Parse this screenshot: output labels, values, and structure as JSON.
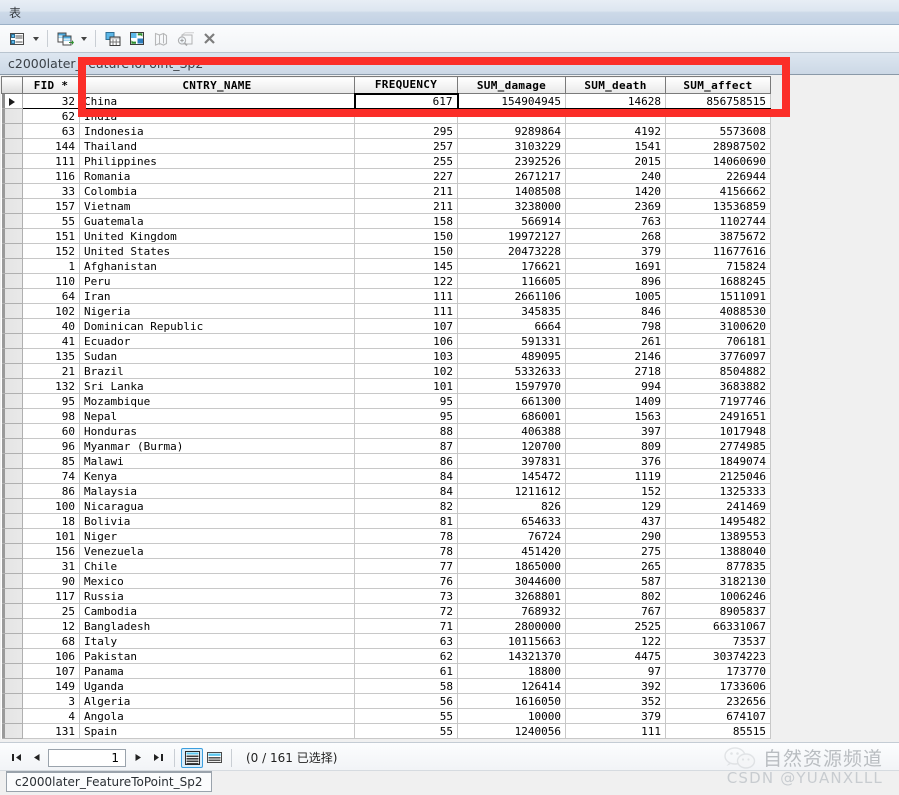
{
  "window": {
    "title": "表"
  },
  "toolbar": {
    "icons": [
      {
        "name": "table-options-icon",
        "label": "表选项"
      },
      {
        "name": "table-options-dropdown-icon",
        "label": ""
      },
      {
        "name": "related-tables-icon",
        "label": "相关表"
      },
      {
        "name": "related-tables-dropdown-icon",
        "label": ""
      },
      {
        "name": "select-all-icon",
        "label": "全选"
      },
      {
        "name": "switch-selection-icon",
        "label": "切换选择"
      },
      {
        "name": "zoom-to-selected-icon",
        "label": "缩放至所选"
      },
      {
        "name": "zoom-layer-icon",
        "label": "缩放"
      },
      {
        "name": "clear-selection-icon",
        "label": "清除所选内容"
      }
    ]
  },
  "layer_tab": {
    "name": "c2000later_FeatureToPoint_Sp2"
  },
  "table": {
    "columns": [
      {
        "key": "fid",
        "label": "FID *",
        "align": "right"
      },
      {
        "key": "name",
        "label": "CNTRY_NAME",
        "align": "left"
      },
      {
        "key": "freq",
        "label": "FREQUENCY",
        "align": "right"
      },
      {
        "key": "damage",
        "label": "SUM_damage",
        "align": "right"
      },
      {
        "key": "death",
        "label": "SUM_death",
        "align": "right"
      },
      {
        "key": "affect",
        "label": "SUM_affect",
        "align": "right"
      }
    ],
    "current_row_index": 0,
    "rows": [
      {
        "fid": "32",
        "name": "China",
        "freq": "617",
        "damage": "154904945",
        "death": "14628",
        "affect": "856758515"
      },
      {
        "fid": "62",
        "name": "India",
        "freq": "",
        "damage": "",
        "death": "",
        "affect": ""
      },
      {
        "fid": "63",
        "name": "Indonesia",
        "freq": "295",
        "damage": "9289864",
        "death": "4192",
        "affect": "5573608"
      },
      {
        "fid": "144",
        "name": "Thailand",
        "freq": "257",
        "damage": "3103229",
        "death": "1541",
        "affect": "28987502"
      },
      {
        "fid": "111",
        "name": "Philippines",
        "freq": "255",
        "damage": "2392526",
        "death": "2015",
        "affect": "14060690"
      },
      {
        "fid": "116",
        "name": "Romania",
        "freq": "227",
        "damage": "2671217",
        "death": "240",
        "affect": "226944"
      },
      {
        "fid": "33",
        "name": "Colombia",
        "freq": "211",
        "damage": "1408508",
        "death": "1420",
        "affect": "4156662"
      },
      {
        "fid": "157",
        "name": "Vietnam",
        "freq": "211",
        "damage": "3238000",
        "death": "2369",
        "affect": "13536859"
      },
      {
        "fid": "55",
        "name": "Guatemala",
        "freq": "158",
        "damage": "566914",
        "death": "763",
        "affect": "1102744"
      },
      {
        "fid": "151",
        "name": "United Kingdom",
        "freq": "150",
        "damage": "19972127",
        "death": "268",
        "affect": "3875672"
      },
      {
        "fid": "152",
        "name": "United States",
        "freq": "150",
        "damage": "20473228",
        "death": "379",
        "affect": "11677616"
      },
      {
        "fid": "1",
        "name": "Afghanistan",
        "freq": "145",
        "damage": "176621",
        "death": "1691",
        "affect": "715824"
      },
      {
        "fid": "110",
        "name": "Peru",
        "freq": "122",
        "damage": "116605",
        "death": "896",
        "affect": "1688245"
      },
      {
        "fid": "64",
        "name": "Iran",
        "freq": "111",
        "damage": "2661106",
        "death": "1005",
        "affect": "1511091"
      },
      {
        "fid": "102",
        "name": "Nigeria",
        "freq": "111",
        "damage": "345835",
        "death": "846",
        "affect": "4088530"
      },
      {
        "fid": "40",
        "name": "Dominican Republic",
        "freq": "107",
        "damage": "6664",
        "death": "798",
        "affect": "3100620"
      },
      {
        "fid": "41",
        "name": "Ecuador",
        "freq": "106",
        "damage": "591331",
        "death": "261",
        "affect": "706181"
      },
      {
        "fid": "135",
        "name": "Sudan",
        "freq": "103",
        "damage": "489095",
        "death": "2146",
        "affect": "3776097"
      },
      {
        "fid": "21",
        "name": "Brazil",
        "freq": "102",
        "damage": "5332633",
        "death": "2718",
        "affect": "8504882"
      },
      {
        "fid": "132",
        "name": "Sri Lanka",
        "freq": "101",
        "damage": "1597970",
        "death": "994",
        "affect": "3683882"
      },
      {
        "fid": "95",
        "name": "Mozambique",
        "freq": "95",
        "damage": "661300",
        "death": "1409",
        "affect": "7197746"
      },
      {
        "fid": "98",
        "name": "Nepal",
        "freq": "95",
        "damage": "686001",
        "death": "1563",
        "affect": "2491651"
      },
      {
        "fid": "60",
        "name": "Honduras",
        "freq": "88",
        "damage": "406388",
        "death": "397",
        "affect": "1017948"
      },
      {
        "fid": "96",
        "name": "Myanmar (Burma)",
        "freq": "87",
        "damage": "120700",
        "death": "809",
        "affect": "2774985"
      },
      {
        "fid": "85",
        "name": "Malawi",
        "freq": "86",
        "damage": "397831",
        "death": "376",
        "affect": "1849074"
      },
      {
        "fid": "74",
        "name": "Kenya",
        "freq": "84",
        "damage": "145472",
        "death": "1119",
        "affect": "2125046"
      },
      {
        "fid": "86",
        "name": "Malaysia",
        "freq": "84",
        "damage": "1211612",
        "death": "152",
        "affect": "1325333"
      },
      {
        "fid": "100",
        "name": "Nicaragua",
        "freq": "82",
        "damage": "826",
        "death": "129",
        "affect": "241469"
      },
      {
        "fid": "18",
        "name": "Bolivia",
        "freq": "81",
        "damage": "654633",
        "death": "437",
        "affect": "1495482"
      },
      {
        "fid": "101",
        "name": "Niger",
        "freq": "78",
        "damage": "76724",
        "death": "290",
        "affect": "1389553"
      },
      {
        "fid": "156",
        "name": "Venezuela",
        "freq": "78",
        "damage": "451420",
        "death": "275",
        "affect": "1388040"
      },
      {
        "fid": "31",
        "name": "Chile",
        "freq": "77",
        "damage": "1865000",
        "death": "265",
        "affect": "877835"
      },
      {
        "fid": "90",
        "name": "Mexico",
        "freq": "76",
        "damage": "3044600",
        "death": "587",
        "affect": "3182130"
      },
      {
        "fid": "117",
        "name": "Russia",
        "freq": "73",
        "damage": "3268801",
        "death": "802",
        "affect": "1006246"
      },
      {
        "fid": "25",
        "name": "Cambodia",
        "freq": "72",
        "damage": "768932",
        "death": "767",
        "affect": "8905837"
      },
      {
        "fid": "12",
        "name": "Bangladesh",
        "freq": "71",
        "damage": "2800000",
        "death": "2525",
        "affect": "66331067"
      },
      {
        "fid": "68",
        "name": "Italy",
        "freq": "63",
        "damage": "10115663",
        "death": "122",
        "affect": "73537"
      },
      {
        "fid": "106",
        "name": "Pakistan",
        "freq": "62",
        "damage": "14321370",
        "death": "4475",
        "affect": "30374223"
      },
      {
        "fid": "107",
        "name": "Panama",
        "freq": "61",
        "damage": "18800",
        "death": "97",
        "affect": "173770"
      },
      {
        "fid": "149",
        "name": "Uganda",
        "freq": "58",
        "damage": "126414",
        "death": "392",
        "affect": "1733606"
      },
      {
        "fid": "3",
        "name": "Algeria",
        "freq": "56",
        "damage": "1616050",
        "death": "352",
        "affect": "232656"
      },
      {
        "fid": "4",
        "name": "Angola",
        "freq": "55",
        "damage": "10000",
        "death": "379",
        "affect": "674107"
      },
      {
        "fid": "131",
        "name": "Spain",
        "freq": "55",
        "damage": "1240056",
        "death": "111",
        "affect": "85515"
      }
    ]
  },
  "statusbar": {
    "first_label": "第一条",
    "prev_label": "上一条",
    "page_value": "1",
    "next_label": "下一条",
    "last_label": "最后一条",
    "view_table_label": "表视图",
    "view_selected_label": "所选记录视图",
    "selection_text": "(0 / 161 已选择)"
  },
  "bottom_tabs": [
    {
      "label": "c2000later_FeatureToPoint_Sp2",
      "active": true
    }
  ],
  "watermark": {
    "channel": "自然资源频道",
    "credit": "CSDN @YUANXLLL"
  },
  "annotation": {
    "highlight_color": "#fb2e28"
  }
}
